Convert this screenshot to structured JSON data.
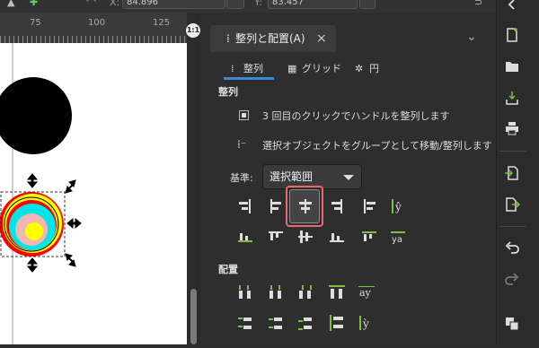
{
  "toolbar": {
    "x_label": "X:",
    "x_value": "84.896",
    "y_label": "Y:",
    "y_value": "83.457"
  },
  "ruler": {
    "ticks": [
      "75",
      "100",
      "125"
    ]
  },
  "dialog": {
    "tab_title": "整列と配置(A)",
    "close_glyph": "×",
    "collapse_glyph": "⌄",
    "subtabs": [
      {
        "label": "整列"
      },
      {
        "label": "グリッド"
      },
      {
        "label": "円"
      }
    ],
    "align_section": {
      "title": "整列",
      "option_handles": "3 回目のクリックでハンドルを整列します",
      "option_group": "選択オブジェクトをグループとして移動/整列します",
      "basis_label": "基準:",
      "basis_value": "選択範囲"
    },
    "arrange_section": {
      "title": "配置"
    }
  },
  "icons": [
    "align-right-of-anchor-icon",
    "align-left-edges-icon",
    "center-on-vertical-axis-icon",
    "align-right-edges-icon",
    "align-left-of-anchor-icon",
    "align-text-baseline-icon",
    "align-bottom-of-anchor-icon",
    "align-top-edges-icon",
    "center-on-horizontal-axis-icon",
    "align-bottom-edges-icon",
    "align-top-of-anchor-icon",
    "align-baseline-vertical-icon"
  ],
  "colors": {
    "panel_bg": "#2e2e2e",
    "accent_underline": "#3a87d6",
    "highlight": "#e8686d"
  }
}
